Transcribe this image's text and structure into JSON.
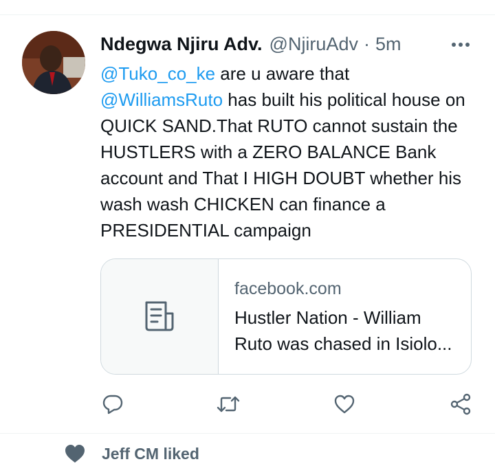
{
  "tweet": {
    "author_name": "Ndegwa Njiru Adv.",
    "handle": "@NjiruAdv",
    "separator": "·",
    "time": "5m",
    "mention_1": "@Tuko_co_ke",
    "text_1": " are u aware that ",
    "mention_2": "@WilliamsRuto",
    "text_2": " has built his political house on QUICK SAND.That RUTO cannot sustain the HUSTLERS with a ZERO BALANCE Bank account and That I HIGH DOUBT whether his wash wash CHICKEN can finance a PRESIDENTIAL campaign"
  },
  "card": {
    "domain": "facebook.com",
    "title": "Hustler Nation - William Ruto was chased in Isiolo..."
  },
  "actions": [
    "reply-icon",
    "retweet-icon",
    "like-icon",
    "share-icon"
  ],
  "social_context": {
    "text": "Jeff CM liked"
  },
  "colors": {
    "link": "#1d9bf0",
    "secondary": "#536471",
    "border": "#cfd9de"
  }
}
